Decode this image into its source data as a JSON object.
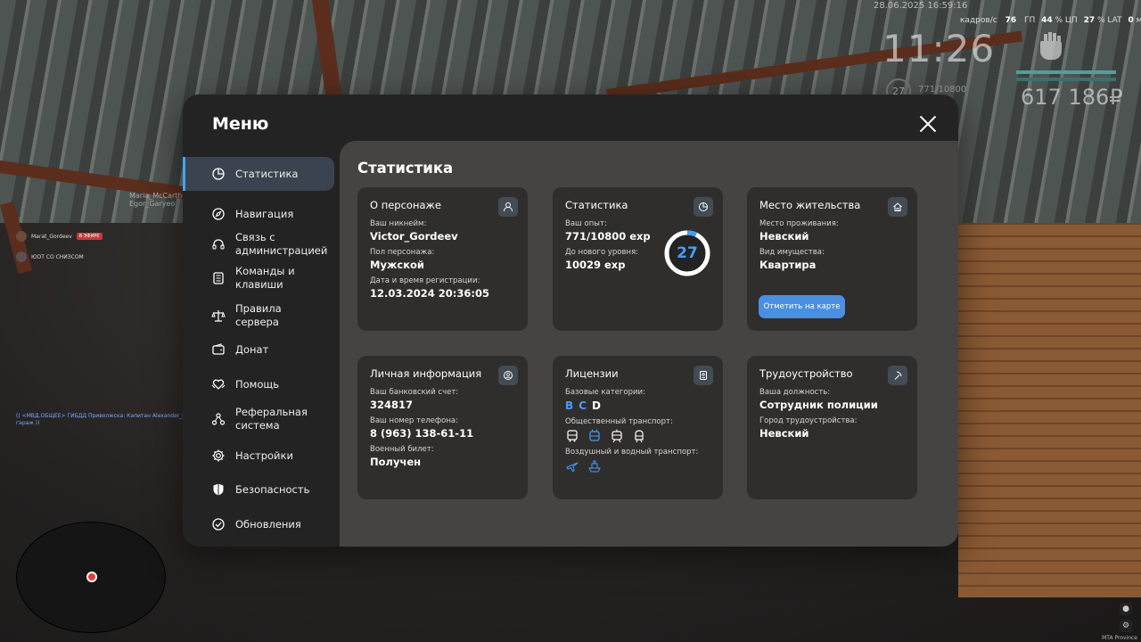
{
  "hud": {
    "datetime": "28.06.2025 16:59:16",
    "fps_label": "кадров/с",
    "fps": "76",
    "gpu_label": "ГП",
    "gpu": "44",
    "cpu_label": "% ЦП",
    "cpu": "27",
    "lat_label": "% LAT",
    "lat": "0",
    "lat_unit": "мс",
    "time": "11:26",
    "money": "617 186₽",
    "level": "27",
    "exp": "771/10800"
  },
  "world": {
    "npc_name": "Maria_McCarthy\nEgor_Garyeo",
    "feed": [
      {
        "name": "Marat_Gordeev",
        "tag": "В ЭФИРЕ"
      },
      {
        "name": "ЮОТ СО СНИЗСОМ",
        "tag": ""
      }
    ],
    "chat": "(( <МВД.ОБЩЕЕ> ГИБДД Приволжска: Капитан Alexander_Ragozin[260]: а гараж ))",
    "mta_label": "MTA Province"
  },
  "menu": {
    "title": "Меню",
    "sidebar": [
      {
        "label": "Статистика",
        "icon": "pie-chart-icon",
        "active": true
      },
      {
        "label": "Навигация",
        "icon": "compass-icon"
      },
      {
        "label": "Связь с администрацией",
        "icon": "headset-icon"
      },
      {
        "label": "Команды и клавиши",
        "icon": "keyboard-icon"
      },
      {
        "label": "Правила сервера",
        "icon": "scales-icon"
      },
      {
        "label": "Донат",
        "icon": "wallet-icon"
      },
      {
        "label": "Помощь",
        "icon": "heart-hands-icon"
      },
      {
        "label": "Реферальная система",
        "icon": "referral-icon"
      },
      {
        "label": "Настройки",
        "icon": "gear-icon"
      },
      {
        "label": "Безопасность",
        "icon": "shield-icon"
      },
      {
        "label": "Обновления",
        "icon": "check-circle-icon"
      }
    ],
    "content_title": "Статистика",
    "cards": {
      "character": {
        "title": "О персонаже",
        "nick_label": "Ваш никнейм:",
        "nick": "Victor_Gordeev",
        "sex_label": "Пол персонажа:",
        "sex": "Мужской",
        "reg_label": "Дата и время регистрации:",
        "reg": "12.03.2024 20:36:05"
      },
      "stats": {
        "title": "Статистика",
        "exp_label": "Ваш опыт:",
        "exp": "771/10800 exp",
        "next_label": "До нового уровня:",
        "next": "10029 exp",
        "level": "27",
        "progress": 0.0714
      },
      "residence": {
        "title": "Место жительства",
        "place_label": "Место проживания:",
        "place": "Невский",
        "property_label": "Вид имущества:",
        "property": "Квартира",
        "button": "Отметить на карте"
      },
      "personal": {
        "title": "Личная информация",
        "bank_label": "Ваш банковский счет:",
        "bank": "324817",
        "phone_label": "Ваш номер телефона:",
        "phone": "8 (963) 138-61-11",
        "military_label": "Военный билет:",
        "military": "Получен"
      },
      "licenses": {
        "title": "Лицензии",
        "base_label": "Базовые категории:",
        "categories": [
          {
            "letter": "B",
            "owned": true
          },
          {
            "letter": "C",
            "owned": true
          },
          {
            "letter": "D",
            "owned": false
          }
        ],
        "public_label": "Общественный транспорт:",
        "air_label": "Воздушный и водный транспорт:"
      },
      "job": {
        "title": "Трудоустройство",
        "position_label": "Ваша должность:",
        "position": "Сотрудник полиции",
        "city_label": "Город трудоустройства:",
        "city": "Невский"
      }
    }
  },
  "colors": {
    "accent": "#4a9bff",
    "panel": "#232323",
    "content": "#464442",
    "card": "#2f2e2d"
  }
}
